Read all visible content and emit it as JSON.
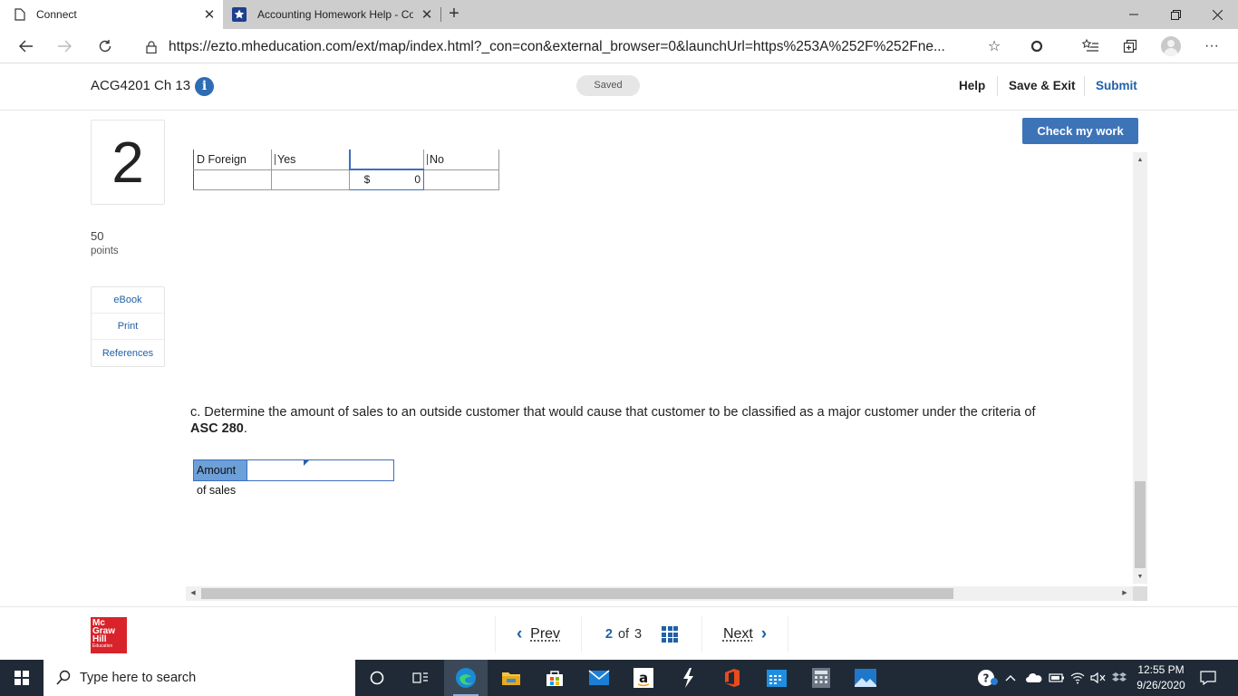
{
  "browser": {
    "tabs": [
      {
        "title": "Connect",
        "active": true
      },
      {
        "title": "Accounting Homework Help - Co",
        "active": false
      }
    ],
    "url": "https://ezto.mheducation.com/ext/map/index.html?_con=con&external_browser=0&launchUrl=https%253A%252F%252Fne..."
  },
  "header": {
    "assignment_title": "ACG4201 Ch 13",
    "info_glyph": "i",
    "saved_label": "Saved",
    "help_label": "Help",
    "save_exit_label": "Save & Exit",
    "submit_label": "Submit"
  },
  "question": {
    "number": "2",
    "points_value": "50",
    "points_label": "points",
    "rail": [
      "eBook",
      "Print",
      "References"
    ],
    "check_label": "Check my work"
  },
  "segment_table": {
    "row_label": "D Foreign",
    "col_yes": "Yes",
    "col_no": "No",
    "currency": "$",
    "amount": "0"
  },
  "part_c": {
    "text_before": "c. Determine the amount of sales to an outside customer that would cause that customer to be classified as a major customer under the criteria of ",
    "standard": "ASC 280",
    "text_after": ".",
    "sales_label": "Amount of sales",
    "sales_value": ""
  },
  "pager": {
    "prev_label": "Prev",
    "current": "2",
    "of_label": "of",
    "total": "3",
    "next_label": "Next"
  },
  "logo": {
    "line1": "Mc",
    "line2": "Graw",
    "line3": "Hill",
    "line4": "Education"
  },
  "taskbar": {
    "search_placeholder": "Type here to search",
    "time": "12:55 PM",
    "date": "9/26/2020"
  },
  "colors": {
    "accent_blue": "#2161a8",
    "button_blue": "#3d74b8",
    "label_fill": "#6d9fd8",
    "brand_red": "#d8232a",
    "taskbar": "#1f2a36"
  }
}
